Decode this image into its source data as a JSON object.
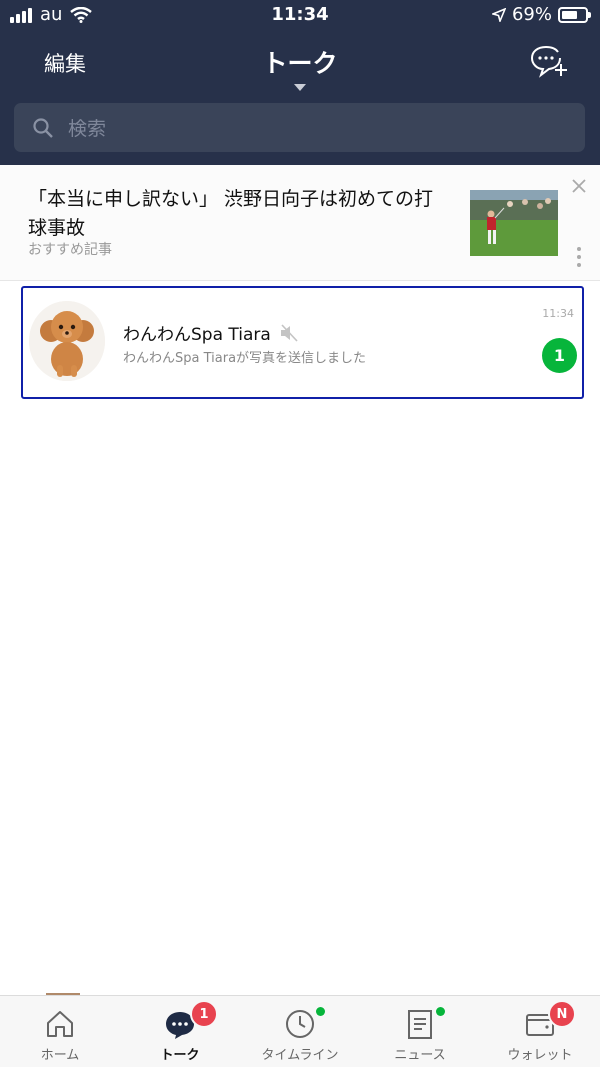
{
  "status_bar": {
    "carrier": "au",
    "time": "11:34",
    "battery": "69%"
  },
  "header": {
    "edit_label": "編集",
    "title": "トーク"
  },
  "search": {
    "placeholder": "検索"
  },
  "ad": {
    "title": "「本当に申し訳ない」 渋野日向子は初めての打球事故",
    "label": "おすすめ記事"
  },
  "chats": [
    {
      "name": "わんわんSpa Tiara",
      "muted": true,
      "preview": "わんわんSpa Tiaraが写真を送信しました",
      "time": "11:34",
      "unread": "1"
    }
  ],
  "tabs": [
    {
      "label": "ホーム",
      "icon": "home-icon"
    },
    {
      "label": "トーク",
      "icon": "talk-icon",
      "badge": "1",
      "active": true
    },
    {
      "label": "タイムライン",
      "icon": "clock-icon",
      "dot": true
    },
    {
      "label": "ニュース",
      "icon": "news-icon",
      "dot": true
    },
    {
      "label": "ウォレット",
      "icon": "wallet-icon",
      "badge": "N"
    }
  ],
  "colors": {
    "header_bg": "#27314a",
    "accent_green": "#07b53b",
    "badge_red": "#e8434f",
    "selection_border": "#1020a8"
  }
}
